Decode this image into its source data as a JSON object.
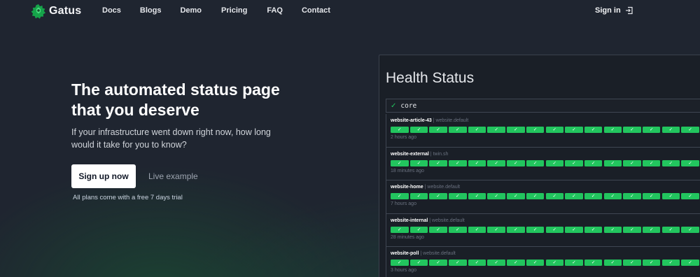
{
  "nav": {
    "brand": "Gatus",
    "links": [
      "Docs",
      "Blogs",
      "Demo",
      "Pricing",
      "FAQ",
      "Contact"
    ],
    "signin": "Sign in"
  },
  "hero": {
    "title": "The automated status page that you deserve",
    "subtitle": "If your infrastructure went down right now, how long would it take for you to know?",
    "signup_label": "Sign up now",
    "live_example_label": "Live example",
    "plans_note": "All plans come with a free 7 days trial"
  },
  "status": {
    "title": "Health Status",
    "group": "core",
    "check_glyph": "✓",
    "endpoints": [
      {
        "name": "website-article-43",
        "group": "website.default",
        "time": "2 hours ago"
      },
      {
        "name": "website-external",
        "group": "twin.sh",
        "time": "18 minutes ago"
      },
      {
        "name": "website-home",
        "group": "website.default",
        "time": "7 hours ago"
      },
      {
        "name": "website-internal",
        "group": "website.default",
        "time": "28 minutes ago"
      },
      {
        "name": "website-poll",
        "group": "website.default",
        "time": "3 hours ago"
      }
    ]
  },
  "colors": {
    "background": "#1f2530",
    "success": "#22c55e",
    "brand_green": "#16a34a"
  },
  "icons": [
    "gatus-logo-icon",
    "sign-in-icon",
    "check-icon"
  ]
}
